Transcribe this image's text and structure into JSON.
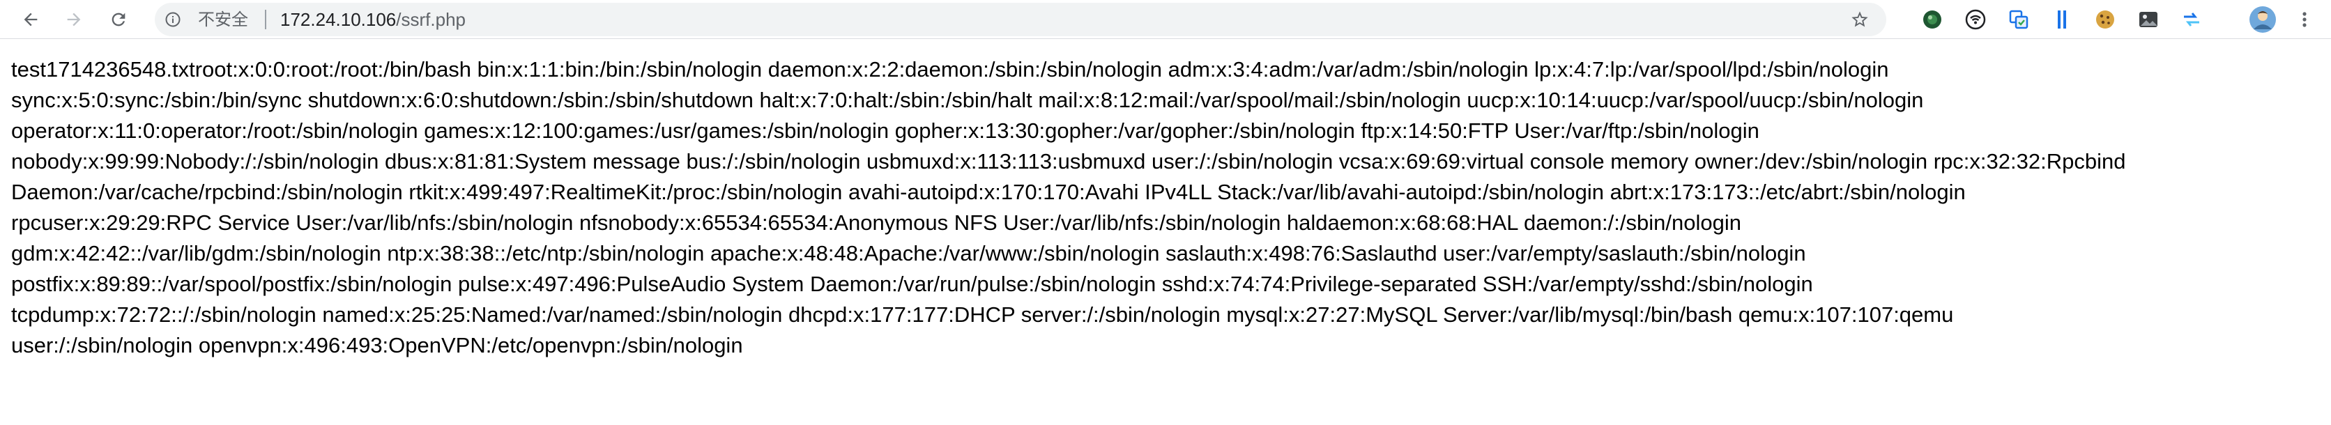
{
  "browser": {
    "security_label": "不安全",
    "url_host": "172.24.10.106",
    "url_path": "/ssrf.php",
    "nav": {
      "back_icon": "arrow-left-icon",
      "forward_icon": "arrow-right-icon",
      "reload_icon": "reload-icon"
    },
    "extensions": [
      {
        "icon": "green-circle-extension-icon",
        "color": "#2e7d32"
      },
      {
        "icon": "wifi-extension-icon",
        "color": "#202124"
      },
      {
        "icon": "copy-extension-icon",
        "color": "#1a73e8"
      },
      {
        "icon": "double-bar-extension-icon",
        "color": "#1a73e8"
      },
      {
        "icon": "cookie-extension-icon",
        "color": "#b8860b"
      },
      {
        "icon": "image-extension-icon",
        "color": "#3c4043"
      },
      {
        "icon": "swap-extension-icon",
        "color": "#1a73e8"
      },
      {
        "icon": "profile-avatar-icon",
        "color": "#6fa8dc"
      },
      {
        "icon": "more-vertical-icon",
        "color": "#5f6368"
      }
    ]
  },
  "page": {
    "content": "test1714236548.txtroot:x:0:0:root:/root:/bin/bash bin:x:1:1:bin:/bin:/sbin/nologin daemon:x:2:2:daemon:/sbin:/sbin/nologin adm:x:3:4:adm:/var/adm:/sbin/nologin lp:x:4:7:lp:/var/spool/lpd:/sbin/nologin\nsync:x:5:0:sync:/sbin:/bin/sync shutdown:x:6:0:shutdown:/sbin:/sbin/shutdown halt:x:7:0:halt:/sbin:/sbin/halt mail:x:8:12:mail:/var/spool/mail:/sbin/nologin uucp:x:10:14:uucp:/var/spool/uucp:/sbin/nologin\noperator:x:11:0:operator:/root:/sbin/nologin games:x:12:100:games:/usr/games:/sbin/nologin gopher:x:13:30:gopher:/var/gopher:/sbin/nologin ftp:x:14:50:FTP User:/var/ftp:/sbin/nologin\nnobody:x:99:99:Nobody:/:/sbin/nologin dbus:x:81:81:System message bus:/:/sbin/nologin usbmuxd:x:113:113:usbmuxd user:/:/sbin/nologin vcsa:x:69:69:virtual console memory owner:/dev:/sbin/nologin rpc:x:32:32:Rpcbind\nDaemon:/var/cache/rpcbind:/sbin/nologin rtkit:x:499:497:RealtimeKit:/proc:/sbin/nologin avahi-autoipd:x:170:170:Avahi IPv4LL Stack:/var/lib/avahi-autoipd:/sbin/nologin abrt:x:173:173::/etc/abrt:/sbin/nologin\nrpcuser:x:29:29:RPC Service User:/var/lib/nfs:/sbin/nologin nfsnobody:x:65534:65534:Anonymous NFS User:/var/lib/nfs:/sbin/nologin haldaemon:x:68:68:HAL daemon:/:/sbin/nologin\ngdm:x:42:42::/var/lib/gdm:/sbin/nologin ntp:x:38:38::/etc/ntp:/sbin/nologin apache:x:48:48:Apache:/var/www:/sbin/nologin saslauth:x:498:76:Saslauthd user:/var/empty/saslauth:/sbin/nologin\npostfix:x:89:89::/var/spool/postfix:/sbin/nologin pulse:x:497:496:PulseAudio System Daemon:/var/run/pulse:/sbin/nologin sshd:x:74:74:Privilege-separated SSH:/var/empty/sshd:/sbin/nologin\ntcpdump:x:72:72::/:/sbin/nologin named:x:25:25:Named:/var/named:/sbin/nologin dhcpd:x:177:177:DHCP server:/:/sbin/nologin mysql:x:27:27:MySQL Server:/var/lib/mysql:/bin/bash qemu:x:107:107:qemu\nuser:/:/sbin/nologin openvpn:x:496:493:OpenVPN:/etc/openvpn:/sbin/nologin"
  }
}
